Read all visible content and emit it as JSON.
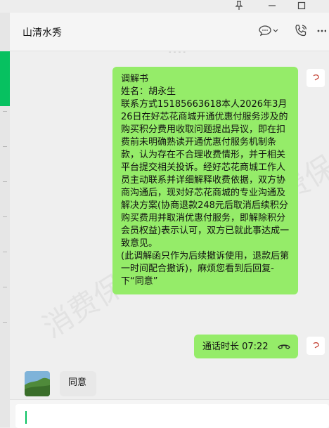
{
  "header": {
    "title": "山清水秀",
    "chat_icon": "chat-bubble-icon",
    "call_icon": "phone-icon"
  },
  "messages": {
    "doc_title": "调解书",
    "doc_name": "姓名：胡永生",
    "doc_body": "联系方式15185663618本人2026年3月26日在好芯花商城开通优惠付服务涉及的购买积分费用收取问题提出异议，即在扣费前未明确熟读开通优惠付服务机制条款，认为存在不合理收费情形，并于相关平台提交相关投诉。经好芯花商城工作人员主动联系并详细解释收费依据，双方协商沟通后，现对好芯花商城的专业沟通及解决方案(协商退款248元后取消后续积分购买费用并取消优惠付服务，即解除积分会员权益)表示认可，双方已就此事达成一致意见。",
    "doc_footer": "(此调解函只作为后续撤诉使用，退款后第一时间配合撤诉)，麻烦您看到后回复-下“同意”",
    "call_label": "通话时长 07:22",
    "reply": "同意"
  },
  "watermark": "消费保",
  "colors": {
    "bubble_green": "#95ec69",
    "accent": "#07c160"
  }
}
